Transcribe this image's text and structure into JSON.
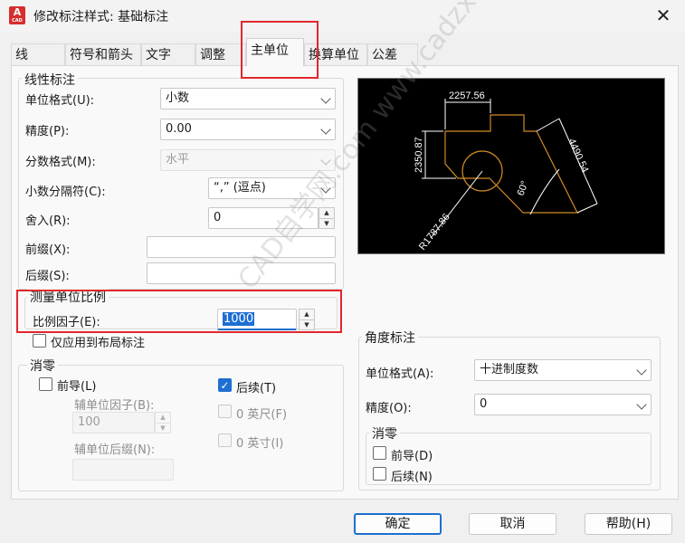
{
  "window": {
    "title": "修改标注样式: 基础标注",
    "app_icon": "A",
    "app_icon_sub": "CAD",
    "close_glyph": "✕"
  },
  "tabs": [
    "线",
    "符号和箭头",
    "文字",
    "调整",
    "主单位",
    "换算单位",
    "公差"
  ],
  "linear": {
    "title": "线性标注",
    "unit_format_label": "单位格式(U):",
    "unit_format_value": "小数",
    "precision_label": "精度(P):",
    "precision_value": "0.00",
    "fraction_label": "分数格式(M):",
    "fraction_value": "水平",
    "decimal_sep_label": "小数分隔符(C):",
    "decimal_sep_value": "“,” (逗点)",
    "roundoff_label": "舍入(R):",
    "roundoff_value": "0",
    "prefix_label": "前缀(X):",
    "prefix_value": "",
    "suffix_label": "后缀(S):",
    "suffix_value": ""
  },
  "scale": {
    "title": "测量单位比例",
    "factor_label": "比例因子(E):",
    "factor_value": "1000",
    "layout_only_label": "仅应用到布局标注"
  },
  "zero_linear": {
    "title": "消零",
    "leading_label": "前导(L)",
    "trailing_label": "后续(T)",
    "sub_factor_label": "辅单位因子(B):",
    "sub_factor_value": "100",
    "sub_suffix_label": "辅单位后缀(N):",
    "sub_suffix_value": "",
    "feet_label": "0 英尺(F)",
    "inches_label": "0 英寸(I)"
  },
  "angular": {
    "title": "角度标注",
    "unit_format_label": "单位格式(A):",
    "unit_format_value": "十进制度数",
    "precision_label": "精度(O):",
    "precision_value": "0",
    "zero_title": "消零",
    "leading_label": "前导(D)",
    "trailing_label": "后续(N)"
  },
  "preview": {
    "dim_top": "2257.56",
    "dim_left": "2350.87",
    "dim_right": "4490.54",
    "angle": "60°",
    "radius": "R1787.86"
  },
  "watermark": "CAD自学网.com  www.cadzxw.com",
  "buttons": {
    "ok": "确定",
    "cancel": "取消",
    "help": "帮助(H)"
  },
  "colors": {
    "highlight_red": "#e0282e",
    "accent_blue": "#1e6fd1",
    "preview_orange": "#d08a26"
  }
}
